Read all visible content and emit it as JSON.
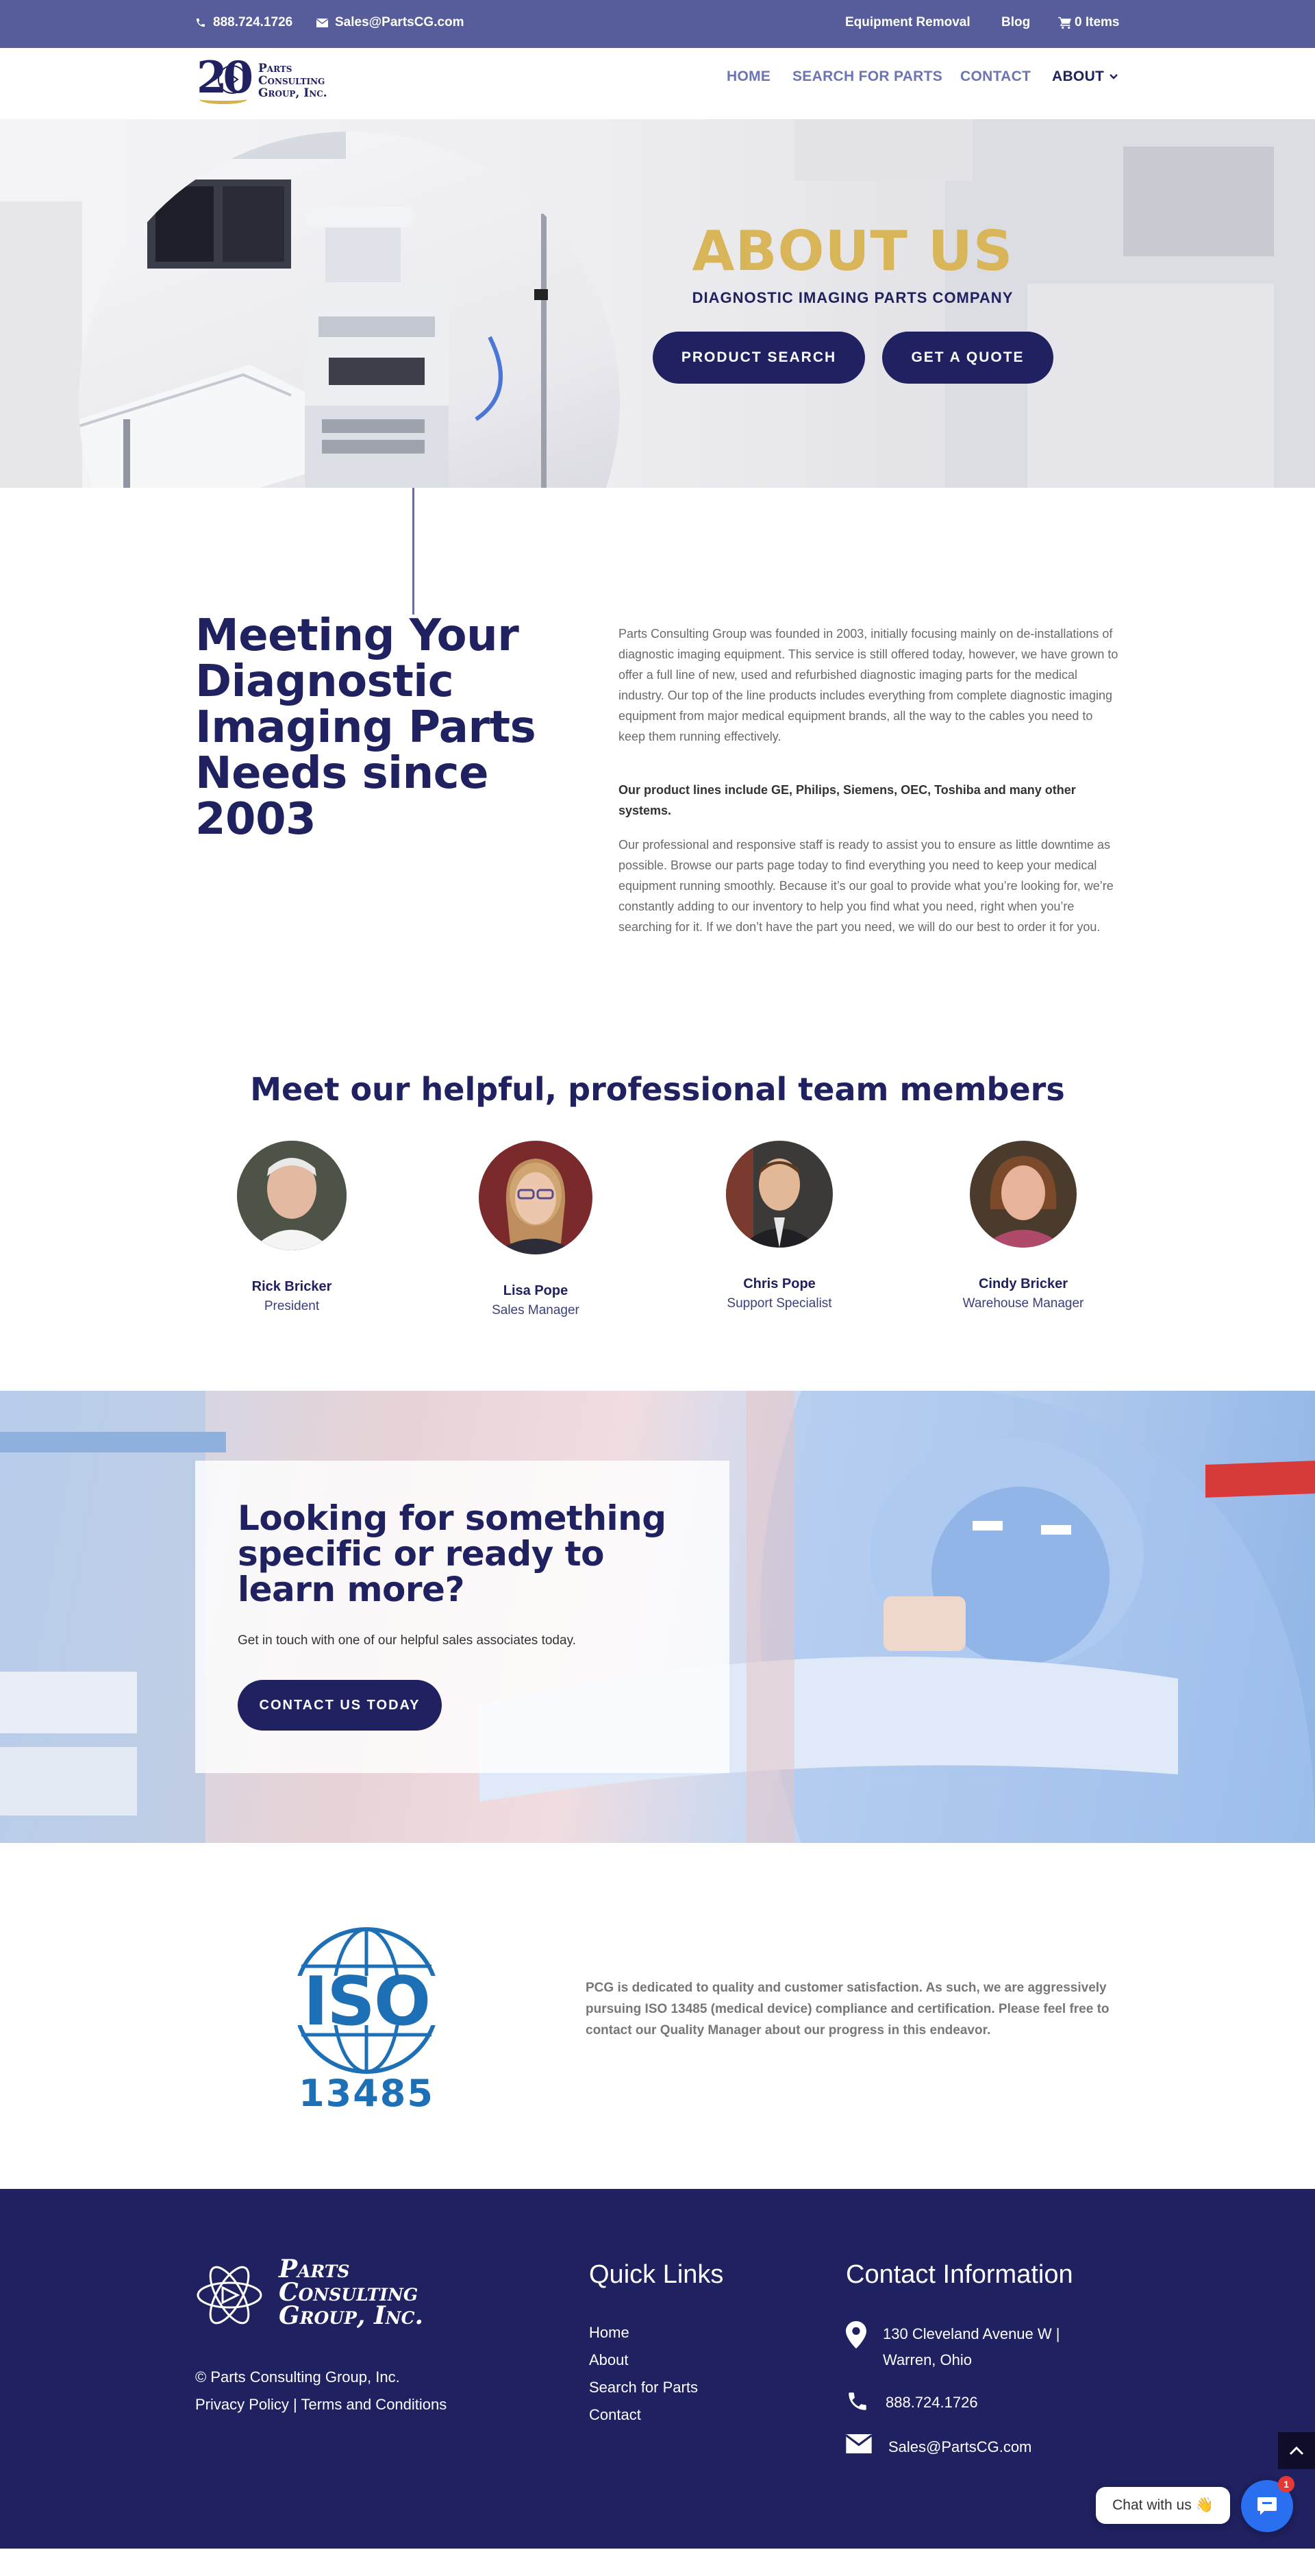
{
  "topbar": {
    "phone": "888.724.1726",
    "email": "Sales@PartsCG.com",
    "links": [
      "Equipment Removal",
      "Blog"
    ],
    "cart": "0 Items",
    "bg_color": "#565d9a"
  },
  "header": {
    "logo_lines": [
      "Parts",
      "Consulting",
      "Group, Inc."
    ],
    "logo_number": "20",
    "nav": [
      "HOME",
      "SEARCH FOR PARTS",
      "CONTACT",
      "ABOUT"
    ],
    "active_nav": "ABOUT"
  },
  "hero": {
    "title": "ABOUT US",
    "subtitle": "DIAGNOSTIC IMAGING PARTS COMPANY",
    "buttons": [
      "PRODUCT SEARCH",
      "GET A QUOTE"
    ]
  },
  "about": {
    "heading": "Meeting Your Diagnostic Imaging Parts Needs since 2003",
    "p1": "Parts Consulting Group was founded in 2003, initially focusing mainly on de-installations of diagnostic imaging equipment. This service is still offered today, however, we have grown to offer a full line of new, used and refurbished diagnostic imaging parts for the medical industry. Our top of the line products includes everything from complete diagnostic imaging equipment from major medical equipment brands, all the way to the cables you need to keep them running effectively.",
    "p2": "Our product lines include GE, Philips, Siemens, OEC, Toshiba and many other systems.",
    "p3": "Our professional and responsive staff is ready to assist you to ensure as little downtime as possible. Browse our parts page today to find everything you need to keep your medical equipment running smoothly. Because it’s our goal to provide what you’re looking for, we’re constantly adding to our inventory to help you find what you need, right when you’re searching for it. If we don’t have the part you need, we will do our best to order it for you."
  },
  "team": {
    "heading": "Meet our helpful, professional team members",
    "members": [
      {
        "name": "Rick Bricker",
        "role": "President"
      },
      {
        "name": "Lisa Pope",
        "role": "Sales Manager"
      },
      {
        "name": "Chris Pope",
        "role": "Support Specialist"
      },
      {
        "name": "Cindy Bricker",
        "role": "Warehouse Manager"
      }
    ]
  },
  "cta": {
    "heading": "Looking for something specific or ready to learn more?",
    "text": "Get in touch with one of our helpful sales associates today.",
    "button": "CONTACT US TODAY"
  },
  "iso": {
    "logo_text": "ISO",
    "logo_number": "13485",
    "text": "PCG is dedicated to quality and customer satisfaction.  As such, we are aggressively pursuing ISO 13485 (medical device) compliance and certification.  Please feel free to contact our Quality Manager about our progress in this endeavor."
  },
  "footer": {
    "logo_lines": [
      "Parts",
      "Consulting",
      "Group, Inc."
    ],
    "copyright": "© Parts Consulting Group, Inc.",
    "privacy": "Privacy Policy",
    "terms": "Terms and Conditions",
    "quick_links_title": "Quick Links",
    "quick_links": [
      "Home",
      "About",
      "Search for Parts",
      "Contact"
    ],
    "contact_title": "Contact Information",
    "address_line1": "130 Cleveland Avenue W |",
    "address_line2": "Warren, Ohio",
    "phone": "888.724.1726",
    "email": "Sales@PartsCG.com",
    "bg_color": "#1f2160"
  },
  "chat": {
    "label": "Chat with us",
    "emoji": "👋",
    "badge": "1"
  }
}
